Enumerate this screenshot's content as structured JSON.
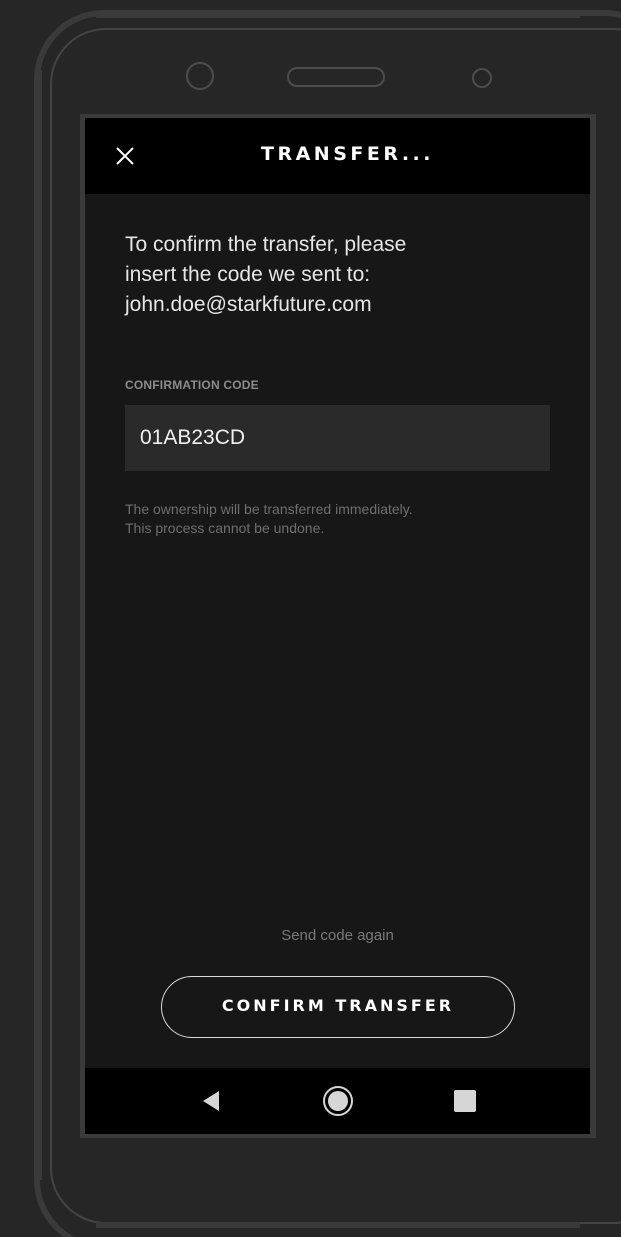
{
  "header": {
    "title": "TRANSFER..."
  },
  "intro": {
    "line1": "To confirm the transfer, please",
    "line2": "insert the code we sent to:",
    "email": "john.doe@starkfuture.com"
  },
  "confirmation_field": {
    "label": "CONFIRMATION CODE",
    "value": "01AB23CD"
  },
  "notice": {
    "line1": "The ownership will be transferred immediately.",
    "line2": "This process cannot be undone."
  },
  "actions": {
    "resend_label": "Send code again",
    "confirm_label": "CONFIRM TRANSFER"
  },
  "icons": {
    "close": "close-icon",
    "back": "back-triangle-icon",
    "home": "home-circle-icon",
    "recents": "recents-square-icon"
  },
  "colors": {
    "background": "#262626",
    "screen": "#171717",
    "header": "#000000",
    "field": "#2a2a2a",
    "text_primary": "#ffffff",
    "text_muted": "#6e6e6e"
  }
}
